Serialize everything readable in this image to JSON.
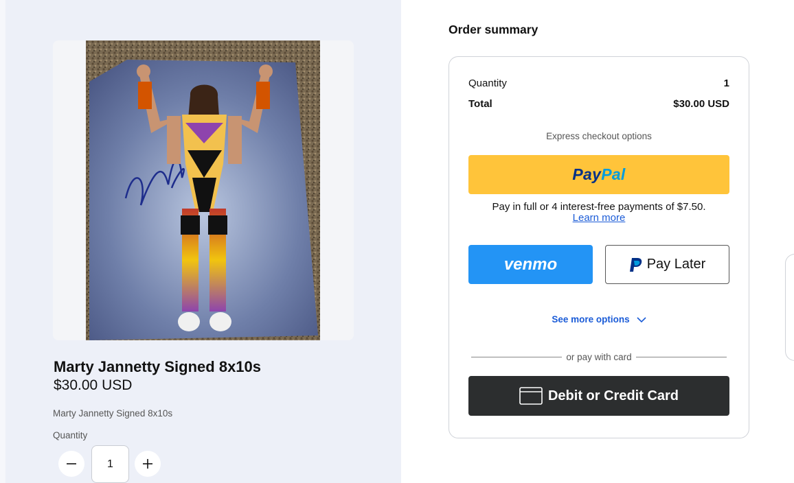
{
  "product": {
    "title": "Marty Jannetty Signed 8x10s",
    "price": "$30.00 USD",
    "description": "Marty Jannetty Signed 8x10s",
    "quantity_label": "Quantity",
    "quantity_value": "1"
  },
  "summary": {
    "heading": "Order summary",
    "quantity_label": "Quantity",
    "quantity_value": "1",
    "total_label": "Total",
    "total_value": "$30.00 USD",
    "express_label": "Express checkout options",
    "paypal_part1": "Pay",
    "paypal_part2": "Pal",
    "paylater_message": "Pay in full or 4 interest-free payments of $7.50.",
    "learn_more": "Learn more",
    "venmo_label": "venmo",
    "pay_later_label": "Pay Later",
    "see_more_label": "See more options",
    "divider_text": "or pay with card",
    "card_button_label": "Debit or Credit Card"
  },
  "colors": {
    "left_bg": "#edf0f8",
    "paypal_yellow": "#ffc43a",
    "paypal_navy": "#003087",
    "paypal_blue": "#009cde",
    "venmo_blue": "#2394f5",
    "card_dark": "#2c2e2f",
    "link_blue": "#1a5bd7"
  },
  "icons": {
    "minus": "minus-icon",
    "plus": "plus-icon",
    "paypal_p": "paypal-p-icon",
    "chevron": "chevron-down-icon",
    "card": "credit-card-icon"
  }
}
